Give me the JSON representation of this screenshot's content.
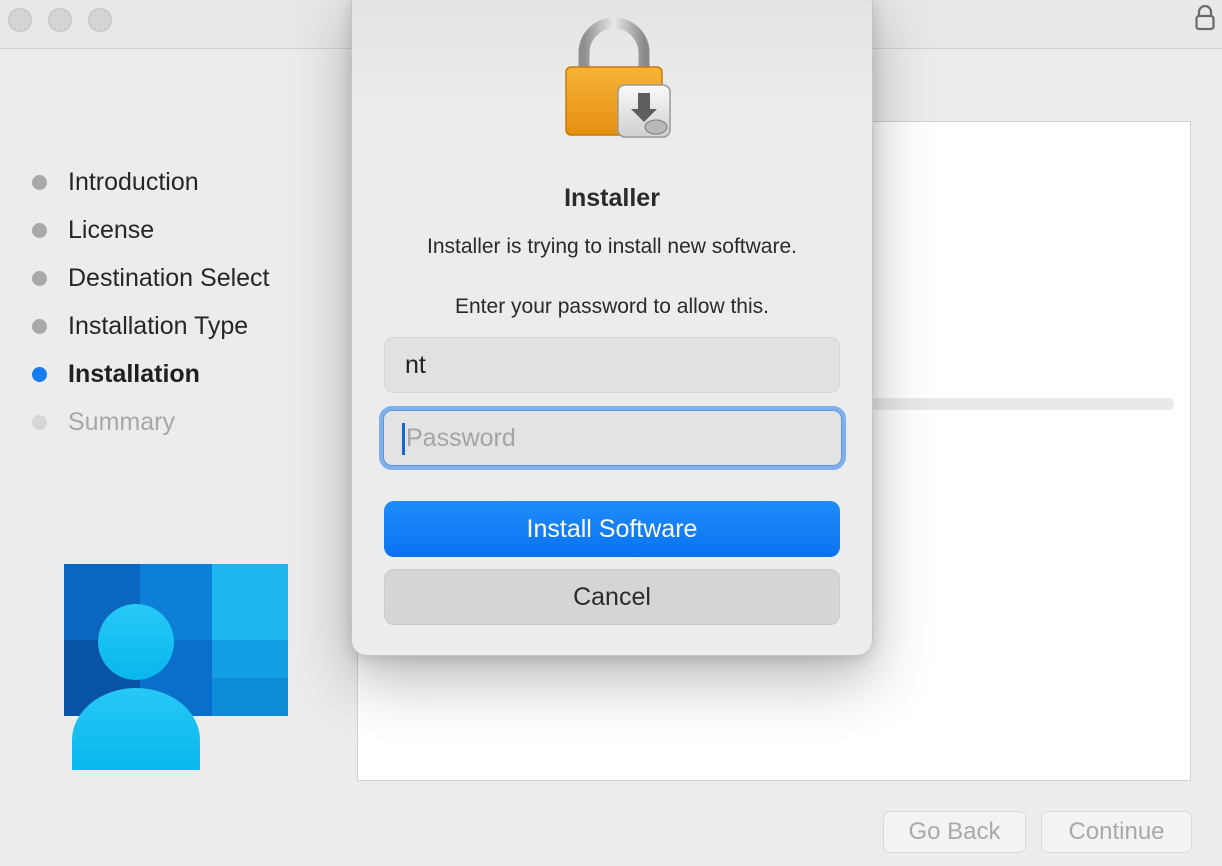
{
  "window": {
    "traffic_lights": [
      "close",
      "minimize",
      "zoom"
    ],
    "lock_icon": "padlock-icon"
  },
  "sidebar": {
    "steps": [
      {
        "label": "Introduction",
        "state": "done"
      },
      {
        "label": "License",
        "state": "done"
      },
      {
        "label": "Destination Select",
        "state": "done"
      },
      {
        "label": "Installation Type",
        "state": "done"
      },
      {
        "label": "Installation",
        "state": "active"
      },
      {
        "label": "Summary",
        "state": "pending"
      }
    ]
  },
  "footer": {
    "go_back": "Go Back",
    "continue": "Continue"
  },
  "dialog": {
    "icon": "installer-lock-icon",
    "title": "Installer",
    "message": "Installer is trying to install new software.",
    "prompt": "Enter your password to allow this.",
    "username_value": "nt",
    "password_placeholder": "Password",
    "install_button": "Install Software",
    "cancel_button": "Cancel"
  },
  "colors": {
    "accent": "#0a72f0",
    "active_dot": "#1a7cf4",
    "lock_orange": "#f3a321"
  }
}
